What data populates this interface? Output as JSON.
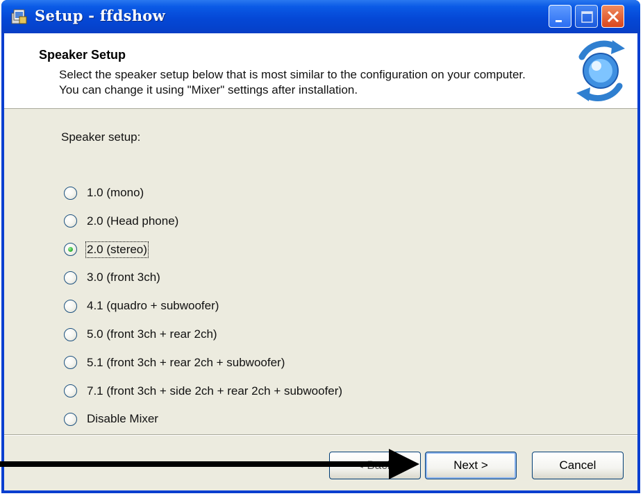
{
  "window": {
    "title": "Setup - ffdshow",
    "controls": [
      "minimize",
      "maximize",
      "close"
    ]
  },
  "header": {
    "title": "Speaker Setup",
    "description": "Select the speaker setup below that is most similar to the configuration on your computer. You can change it using \"Mixer\" settings after installation.",
    "logo_icon": "setup-logo-icon"
  },
  "speaker": {
    "prompt": "Speaker setup:",
    "selected_index": 2,
    "options": [
      "1.0 (mono)",
      "2.0 (Head phone)",
      "2.0 (stereo)",
      "3.0 (front 3ch)",
      "4.1 (quadro + subwoofer)",
      "5.0 (front 3ch + rear 2ch)",
      "5.1 (front 3ch + rear 2ch + subwoofer)",
      "7.1 (front 3ch + side 2ch + rear 2ch + subwoofer)",
      "Disable Mixer"
    ]
  },
  "buttons": {
    "back": "< Back",
    "next": "Next >",
    "cancel": "Cancel"
  },
  "colors": {
    "titlebar": "#0548d6",
    "dialog_background": "#ecebdf",
    "selected_radio": "#33b43a",
    "annotation_arrow": "#000000"
  }
}
